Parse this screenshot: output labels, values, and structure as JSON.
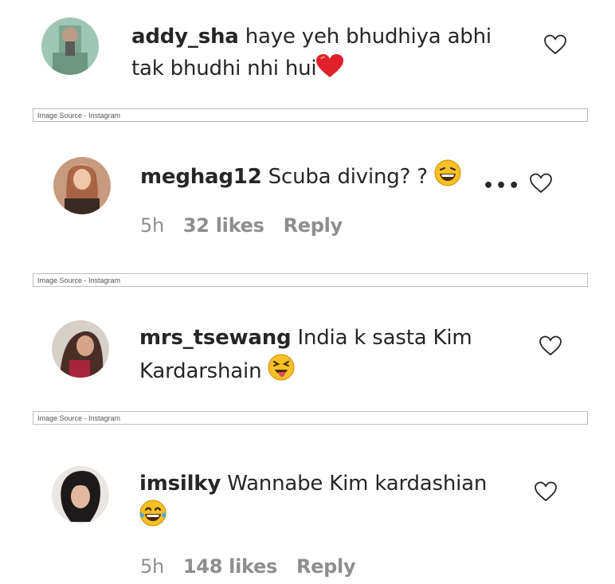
{
  "comments": [
    {
      "username": "addy_sha",
      "line1": "haye yeh bhudhiya abhi",
      "line2": "tak bhudhi nhi hui",
      "emoji": "heart-emoji"
    },
    {
      "username": "meghag12",
      "line1": "Scuba diving? ?",
      "emoji": "laughing-emoji",
      "time": "5h",
      "likes": "32 likes",
      "reply": "Reply",
      "more": "•••"
    },
    {
      "username": "mrs_tsewang",
      "line1": "India k sasta Kim",
      "line2": "Kardarshain",
      "emoji": "tongue-out-emoji"
    },
    {
      "username": "imsilky",
      "line1": "Wannabe Kim kardashian",
      "emoji": "tears-of-joy-emoji",
      "time": "5h",
      "likes": "148 likes",
      "reply": "Reply"
    }
  ],
  "source_label": "Image Source - Instagram",
  "colors": {
    "text": "#262626",
    "meta": "#8e8e8e",
    "heart": "#e0202a",
    "emoji": "#f6c026"
  }
}
